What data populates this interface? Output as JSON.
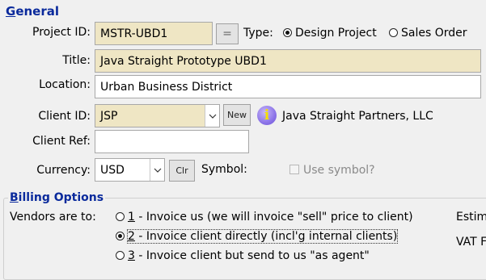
{
  "general": {
    "section_underlined": "G",
    "section_rest": "eneral",
    "project_id_label": "Project ID:",
    "project_id_value": "MSTR-UBD1",
    "equals_button": "=",
    "type_label": "Type:",
    "type_options": [
      {
        "label": "Design Project",
        "selected": true
      },
      {
        "label": "Sales Order",
        "selected": false
      }
    ],
    "title_label": "Title:",
    "title_value": "Java Straight Prototype UBD1",
    "location_label": "Location:",
    "location_value": "Urban Business District",
    "client_id_label": "Client ID:",
    "client_id_value": "JSP",
    "new_button": "New",
    "client_name": "Java Straight Partners, LLC",
    "client_ref_label": "Client Ref:",
    "client_ref_value": "",
    "currency_label": "Currency:",
    "currency_value": "USD",
    "clr_button": "Clr",
    "symbol_label": "Symbol:",
    "use_symbol_label": "Use symbol?",
    "use_symbol_checked": false
  },
  "billing": {
    "section_underlined": "B",
    "section_rest": "illing Options",
    "vendors_label": "Vendors are to:",
    "options": [
      {
        "num": "1",
        "text": " - Invoice us (we will invoice \"sell\" price to client)",
        "selected": false
      },
      {
        "num": "2",
        "text": " - Invoice client directly (incl'g internal clients)",
        "selected": true
      },
      {
        "num": "3",
        "text": " - Invoice client but send to us \"as agent\"",
        "selected": false
      }
    ],
    "right_label_1": "Estim",
    "right_label_2": "VAT F"
  },
  "colors": {
    "required_field": "#efe6c4",
    "section_title": "#0a2a9c",
    "info_icon": "#8c74e8"
  }
}
